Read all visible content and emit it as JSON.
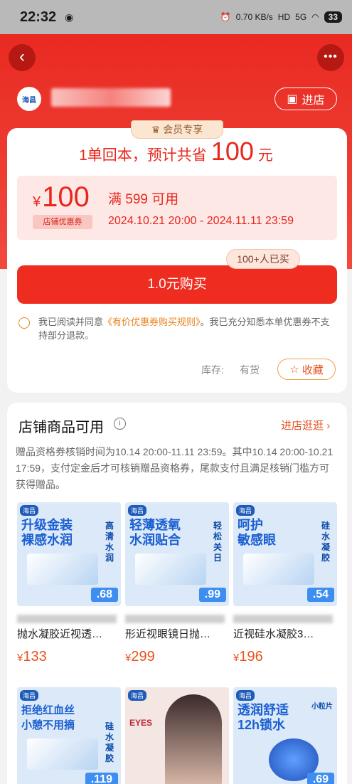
{
  "status_bar": {
    "time": "22:32",
    "net_speed": "0.70 KB/s",
    "hd": "HD",
    "signal": "5G",
    "battery": "33"
  },
  "shop": {
    "logo_text": "海昌",
    "enter_label": "进店"
  },
  "coupon": {
    "member_tag": "会员专享",
    "headline_prefix": "1单回本，预计共省",
    "headline_amount": "100",
    "headline_suffix": "元",
    "currency": "¥",
    "amount": "100",
    "type_label": "店铺优惠券",
    "condition": "满 599 可用",
    "valid_period": "2024.10.21 20:00 - 2024.11.11 23:59",
    "buy_label": "1.0元购买",
    "buyers_badge": "100+人已买",
    "agree_prefix": "我已阅读并同意",
    "agree_link": "《有价优惠券购买规则》",
    "agree_suffix": "。我已充分知悉本单优惠券不支持部分退款。",
    "stock_label": "库存:",
    "stock_value": "有货",
    "favorite_label": "收藏"
  },
  "products_section": {
    "title": "店铺商品可用",
    "goto_label": "进店逛逛",
    "description": "赠品资格券核销时间为10.14 20:00-11.11 23:59。其中10.14 20:00-10.21 17:59，支付定金后才可核销赠品资格券，尾款支付且满足核销门槛方可获得赠品。",
    "products": [
      {
        "slogan": "升级金装\n裸感水润",
        "sub": "高清水润",
        "pill": ".68",
        "name": "抛水凝胶近视透…",
        "currency": "¥",
        "price": "133"
      },
      {
        "slogan": "轻薄透氧\n水润贴合",
        "sub": "轻松关日",
        "pill": ".99",
        "name": "形近视眼镜日抛…",
        "currency": "¥",
        "price": "299"
      },
      {
        "slogan": "呵护\n敏感眼",
        "sub": "硅水凝胶",
        "pill": ".54",
        "name": "近视硅水凝胶3…",
        "currency": "¥",
        "price": "196"
      },
      {
        "slogan": "拒绝红血丝\n小憩不用摘",
        "sub": "硅水凝胶",
        "pill": ".119",
        "name": "",
        "currency": "",
        "price": ""
      },
      {
        "slogan": "EYES",
        "sub": "",
        "pill": "",
        "name": "",
        "currency": "",
        "price": ""
      },
      {
        "slogan": "透润舒适\n12h锁水",
        "sub": "小粒片",
        "pill": ".69",
        "name": "",
        "currency": "",
        "price": ""
      }
    ]
  }
}
